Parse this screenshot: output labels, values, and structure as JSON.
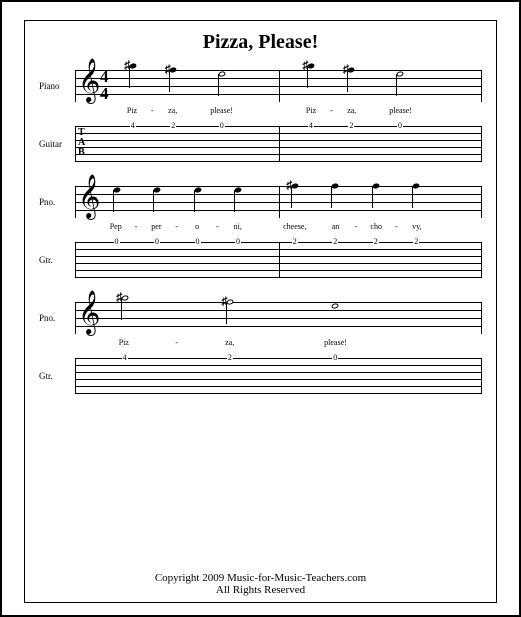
{
  "title": "Pizza, Please!",
  "copyright_line1": "Copyright 2009 Music-for-Music-Teachers.com",
  "copyright_line2": "All Rights Reserved",
  "instruments": {
    "piano_full": "Piano",
    "piano_abbr": "Pno.",
    "guitar_full": "Guitar",
    "guitar_abbr": "Gtr."
  },
  "clef_glyph": "𝄞",
  "time_sig": {
    "num": "4",
    "den": "4"
  },
  "tab_letters": {
    "t": "T",
    "a": "A",
    "b": "B"
  },
  "chart_data": {
    "type": "table",
    "description": "Sheet music with piano staff notes (pitch names), guitar tablature fret numbers, and lyrics, three systems.",
    "systems": [
      {
        "measures": 2,
        "notes": [
          {
            "x": 14,
            "pitch": "G#5",
            "dur": "q",
            "sharp": true
          },
          {
            "x": 24,
            "pitch": "F#5",
            "dur": "q",
            "sharp": true
          },
          {
            "x": 36,
            "pitch": "E5",
            "dur": "h"
          },
          {
            "x": 58,
            "pitch": "G#5",
            "dur": "q",
            "sharp": true
          },
          {
            "x": 68,
            "pitch": "F#5",
            "dur": "q",
            "sharp": true
          },
          {
            "x": 80,
            "pitch": "E5",
            "dur": "h"
          }
        ],
        "lyrics": [
          {
            "x": 14,
            "text": "Piz"
          },
          {
            "x": 19,
            "text": "-"
          },
          {
            "x": 24,
            "text": "za,"
          },
          {
            "x": 36,
            "text": "please!"
          },
          {
            "x": 58,
            "text": "Piz"
          },
          {
            "x": 63,
            "text": "-"
          },
          {
            "x": 68,
            "text": "za,"
          },
          {
            "x": 80,
            "text": "please!"
          }
        ],
        "tab": [
          {
            "x": 14,
            "string": 1,
            "fret": "4"
          },
          {
            "x": 24,
            "string": 1,
            "fret": "2"
          },
          {
            "x": 36,
            "string": 1,
            "fret": "0"
          },
          {
            "x": 58,
            "string": 1,
            "fret": "4"
          },
          {
            "x": 68,
            "string": 1,
            "fret": "2"
          },
          {
            "x": 80,
            "string": 1,
            "fret": "0"
          }
        ]
      },
      {
        "measures": 2,
        "notes": [
          {
            "x": 10,
            "pitch": "E5",
            "dur": "q"
          },
          {
            "x": 20,
            "pitch": "E5",
            "dur": "q"
          },
          {
            "x": 30,
            "pitch": "E5",
            "dur": "q"
          },
          {
            "x": 40,
            "pitch": "E5",
            "dur": "q"
          },
          {
            "x": 54,
            "pitch": "F#5",
            "dur": "q",
            "sharp": true
          },
          {
            "x": 64,
            "pitch": "F#5",
            "dur": "q"
          },
          {
            "x": 74,
            "pitch": "F#5",
            "dur": "q"
          },
          {
            "x": 84,
            "pitch": "F#5",
            "dur": "q"
          }
        ],
        "lyrics": [
          {
            "x": 10,
            "text": "Pep"
          },
          {
            "x": 15,
            "text": "-"
          },
          {
            "x": 20,
            "text": "per"
          },
          {
            "x": 25,
            "text": "-"
          },
          {
            "x": 30,
            "text": "o"
          },
          {
            "x": 35,
            "text": "-"
          },
          {
            "x": 40,
            "text": "ni,"
          },
          {
            "x": 54,
            "text": "cheese,"
          },
          {
            "x": 64,
            "text": "an"
          },
          {
            "x": 69,
            "text": "-"
          },
          {
            "x": 74,
            "text": "cho"
          },
          {
            "x": 79,
            "text": "-"
          },
          {
            "x": 84,
            "text": "vy,"
          }
        ],
        "tab": [
          {
            "x": 10,
            "string": 1,
            "fret": "0"
          },
          {
            "x": 20,
            "string": 1,
            "fret": "0"
          },
          {
            "x": 30,
            "string": 1,
            "fret": "0"
          },
          {
            "x": 40,
            "string": 1,
            "fret": "0"
          },
          {
            "x": 54,
            "string": 1,
            "fret": "2"
          },
          {
            "x": 64,
            "string": 1,
            "fret": "2"
          },
          {
            "x": 74,
            "string": 1,
            "fret": "2"
          },
          {
            "x": 84,
            "string": 1,
            "fret": "2"
          }
        ]
      },
      {
        "measures": 1,
        "notes": [
          {
            "x": 12,
            "pitch": "G#5",
            "dur": "h",
            "sharp": true
          },
          {
            "x": 38,
            "pitch": "F#5",
            "dur": "h",
            "sharp": true
          },
          {
            "x": 64,
            "pitch": "E5",
            "dur": "w"
          }
        ],
        "lyrics": [
          {
            "x": 12,
            "text": "Piz"
          },
          {
            "x": 25,
            "text": "-"
          },
          {
            "x": 38,
            "text": "za,"
          },
          {
            "x": 64,
            "text": "please!"
          }
        ],
        "tab": [
          {
            "x": 12,
            "string": 1,
            "fret": "4"
          },
          {
            "x": 38,
            "string": 1,
            "fret": "2"
          },
          {
            "x": 64,
            "string": 1,
            "fret": "0"
          }
        ]
      }
    ]
  }
}
